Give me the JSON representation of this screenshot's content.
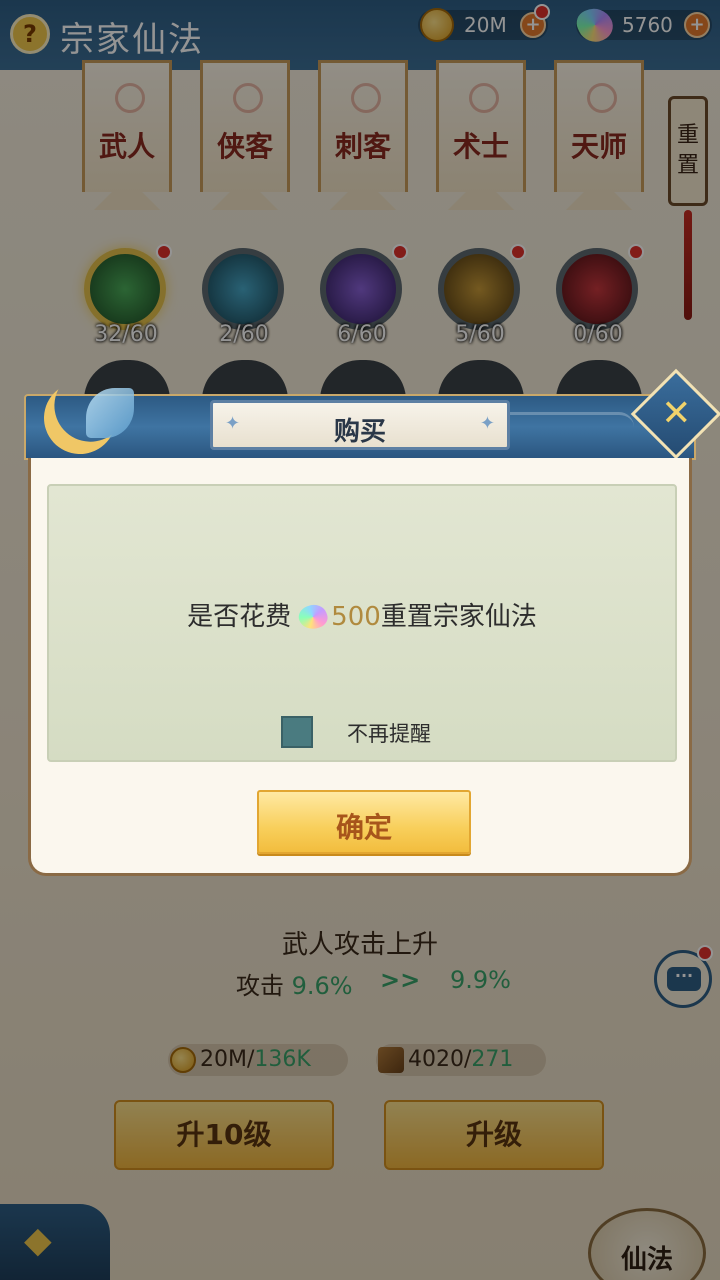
{
  "header": {
    "title": "宗家仙法",
    "help_label": "?",
    "coins": "20M",
    "gems": "5760",
    "plus_label": "+"
  },
  "classes": [
    {
      "label": "武人"
    },
    {
      "label": "侠客"
    },
    {
      "label": "刺客"
    },
    {
      "label": "术士"
    },
    {
      "label": "天师"
    }
  ],
  "reset_label": "重置",
  "orbs": [
    {
      "count": "32/60",
      "color": "#2f7a3a"
    },
    {
      "count": "2/60",
      "color": "#2d6f86"
    },
    {
      "count": "6/60",
      "color": "#5a3aa0"
    },
    {
      "count": "5/60",
      "color": "#8a6a1e"
    },
    {
      "count": "0/60",
      "color": "#8a1f24"
    }
  ],
  "skill": {
    "name": "武人攻击上升",
    "stat_label": "攻击",
    "current": "9.6%",
    "arrow": ">>",
    "next": "9.9%"
  },
  "costs": {
    "coin": "20M/",
    "coin_need": "136K",
    "item": "4020/",
    "item_need": "271"
  },
  "buttons": {
    "upgrade10": "升10级",
    "upgrade": "升级"
  },
  "bottom": {
    "magic_tab": "仙法"
  },
  "dialog": {
    "title": "购买",
    "message_prefix": "是否花费",
    "amount": "500",
    "message_suffix": "重置宗家仙法",
    "checkbox_label": "不再提醒",
    "confirm": "确定"
  },
  "colors": {
    "accent_blue": "#2f5f86",
    "gold": "#f2c94c",
    "green_value": "#3aa36a"
  }
}
